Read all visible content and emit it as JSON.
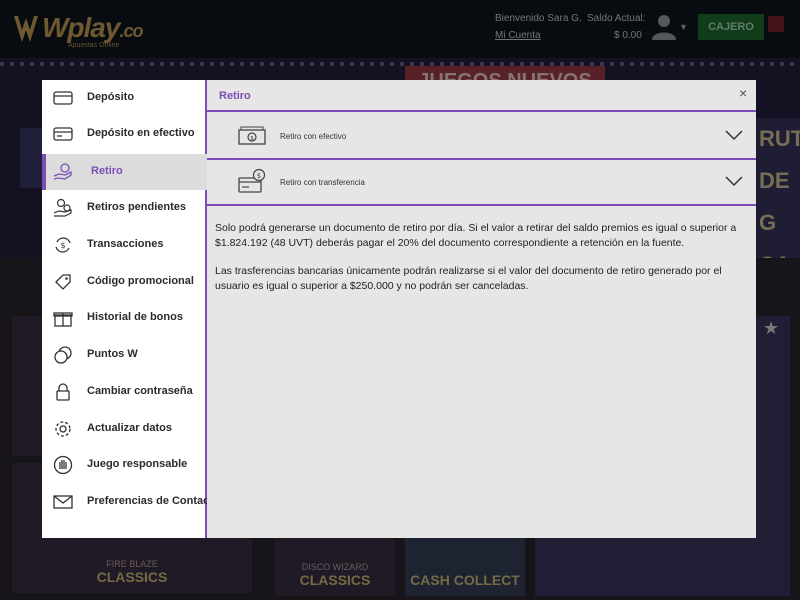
{
  "header": {
    "logo_text": "Wplay",
    "logo_suffix": ".co",
    "logo_tagline": "Apuestas Online",
    "welcome": "Bienvenido  Sara G.",
    "my_account": "Mi Cuenta",
    "balance_label": "Saldo Actual:",
    "balance_value": "$ 0.00",
    "cashier_button": "CAJERO"
  },
  "background": {
    "promo_banner": "JUEGOS NUEVOS",
    "side_text": [
      "RUTA",
      "DE G",
      "CA"
    ],
    "games": [
      {
        "name": "CLASSICS",
        "sub": "FIRE BLAZE"
      },
      {
        "name": "CLASSICS",
        "sub": "DISCO WIZARD"
      },
      {
        "name": "CASH COLLECT",
        "sub": ""
      }
    ]
  },
  "modal": {
    "menu": [
      {
        "label": "Depósito",
        "icon": "card-icon"
      },
      {
        "label": "Depósito en efectivo",
        "icon": "cash-card-icon"
      },
      {
        "label": "Retiro",
        "icon": "hand-coin-icon"
      },
      {
        "label": "Retiros pendientes",
        "icon": "pending-coins-icon"
      },
      {
        "label": "Transacciones",
        "icon": "transactions-icon"
      },
      {
        "label": "Código promocional",
        "icon": "tag-icon"
      },
      {
        "label": "Historial de bonos",
        "icon": "gift-icon"
      },
      {
        "label": "Puntos W",
        "icon": "coins-icon"
      },
      {
        "label": "Cambiar contraseña",
        "icon": "lock-icon"
      },
      {
        "label": "Actualizar datos",
        "icon": "gear-icon"
      },
      {
        "label": "Juego responsable",
        "icon": "hand-stop-icon"
      },
      {
        "label": "Preferencias de Contacto",
        "icon": "envelope-icon"
      }
    ],
    "active_item": "Retiro",
    "title": "Retiro",
    "close": "×",
    "options": [
      {
        "label": "Retiro con efectivo",
        "icon": "cash-bill-icon"
      },
      {
        "label": "Retiro con transferencia",
        "icon": "bank-transfer-icon"
      }
    ],
    "info_paragraph_1": "Solo podrá generarse un documento de retiro por día. Si el valor a retirar del saldo premios es igual o superior a $1.824.192 (48 UVT) deberás pagar el 20% del documento correspondiente a retención en la fuente.",
    "info_paragraph_2": "Las trasferencias bancarias únicamente podrán realizarse si el valor del documento de retiro generado por el usuario es igual o superior a $250.000 y no podrán ser canceladas."
  },
  "colors": {
    "accent": "#7c4db5",
    "cashier": "#1f6e31",
    "panel_bg": "#e6e6e6"
  }
}
